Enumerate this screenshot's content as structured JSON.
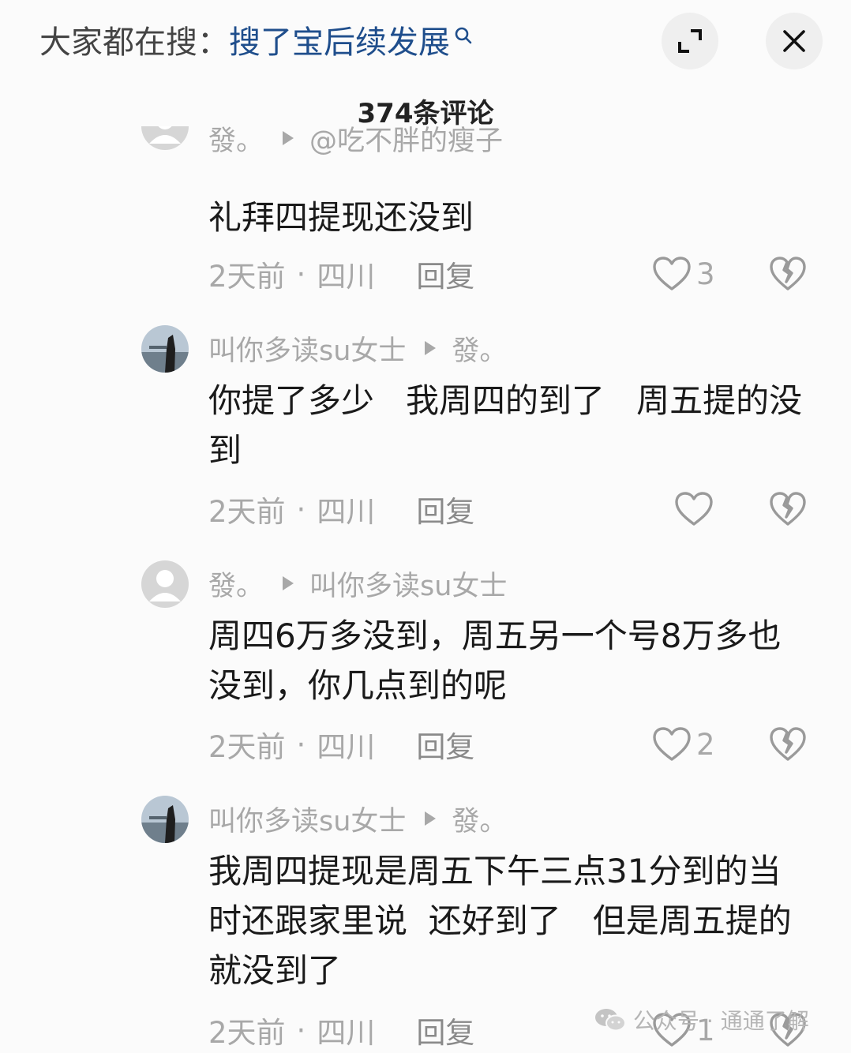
{
  "search": {
    "prefix": "大家都在搜：",
    "term": "搜了宝后续发展"
  },
  "header": {
    "comment_count": "374条评论"
  },
  "comments": [
    {
      "author": "發。",
      "reply_to": "@吃不胖的瘦子",
      "text": "礼拜四提现还没到",
      "time": "2天前",
      "location": "四川",
      "reply_label": "回复",
      "likes": "3"
    },
    {
      "author": "叫你多读su女士",
      "reply_to": "發。",
      "text": "你提了多少   我周四的到了   周五提的没到",
      "time": "2天前",
      "location": "四川",
      "reply_label": "回复",
      "likes": ""
    },
    {
      "author": "發。",
      "reply_to": "叫你多读su女士",
      "text": "周四6万多没到，周五另一个号8万多也没到，你几点到的呢",
      "time": "2天前",
      "location": "四川",
      "reply_label": "回复",
      "likes": "2"
    },
    {
      "author": "叫你多读su女士",
      "reply_to": "發。",
      "text": "我周四提现是周五下午三点31分到的当时还跟家里说  还好到了   但是周五提的就没到了",
      "time": "2天前",
      "location": "四川",
      "reply_label": "回复",
      "likes": "1"
    }
  ],
  "meta_separator": "·",
  "watermark": {
    "text": "公众号 · 通通了解"
  }
}
